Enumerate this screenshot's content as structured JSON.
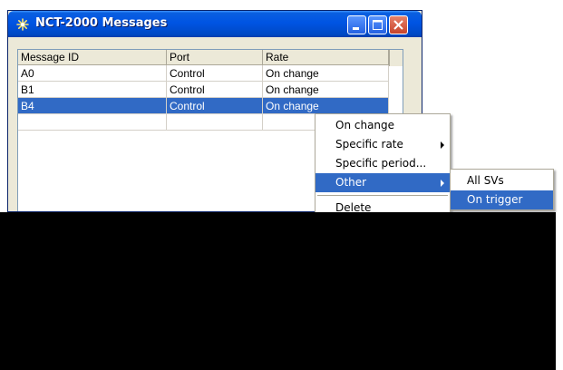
{
  "window": {
    "title": "NCT-2000 Messages"
  },
  "table": {
    "columns": [
      "Message ID",
      "Port",
      "Rate"
    ],
    "rows": [
      {
        "id": "A0",
        "port": "Control",
        "rate": "On change",
        "selected": false
      },
      {
        "id": "B1",
        "port": "Control",
        "rate": "On change",
        "selected": false
      },
      {
        "id": "B4",
        "port": "Control",
        "rate": "On change",
        "selected": true
      }
    ]
  },
  "context_menu": {
    "items": [
      {
        "label": "On change",
        "submenu": false,
        "highlighted": false
      },
      {
        "label": "Specific rate",
        "submenu": true,
        "highlighted": false
      },
      {
        "label": "Specific period...",
        "submenu": false,
        "highlighted": false
      },
      {
        "label": "Other",
        "submenu": true,
        "highlighted": true
      },
      {
        "label": "Delete",
        "submenu": false,
        "highlighted": false
      }
    ]
  },
  "submenu": {
    "items": [
      {
        "label": "All SVs",
        "highlighted": false
      },
      {
        "label": "On trigger",
        "highlighted": true
      }
    ]
  },
  "icons": {
    "app": "sparkle-icon",
    "minimize": "minimize-icon",
    "maximize": "maximize-icon",
    "close": "close-icon"
  },
  "colors": {
    "titlebar": "#0054e3",
    "selection": "#316ac5",
    "close_button": "#c7442b"
  }
}
